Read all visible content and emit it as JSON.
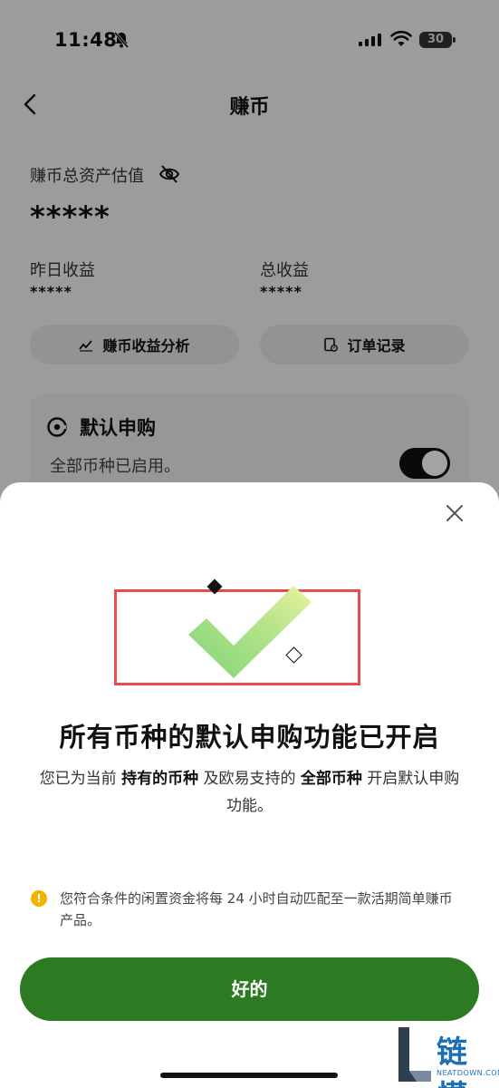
{
  "status_bar": {
    "time": "11:48",
    "battery": "30"
  },
  "nav": {
    "title": "赚币"
  },
  "assets": {
    "label": "赚币总资产估值",
    "value": "*****",
    "yesterday_label": "昨日收益",
    "yesterday_value": "*****",
    "total_label": "总收益",
    "total_value": "*****"
  },
  "actions": {
    "analysis_label": "赚币收益分析",
    "orders_label": "订单记录"
  },
  "auto_subscribe_card": {
    "title": "默认申购",
    "description": "全部币种已启用。",
    "enabled": true
  },
  "sheet": {
    "title": "所有币种的默认申购功能已开启",
    "desc_part1": "您已为当前 ",
    "desc_bold1": "持有的币种",
    "desc_part2": " 及欧易支持的 ",
    "desc_bold2": "全部币种",
    "desc_part3": " 开启默认申购功能。",
    "notice": "您符合条件的闲置资金将每 24 小时自动匹配至一款活期简单赚币产品。",
    "ok_label": "好的"
  },
  "watermark": {
    "text": "链懂",
    "sub": "NEATDOWN.COM"
  },
  "colors": {
    "primary_button": "#2c7a22",
    "highlight_border": "#e84b4b",
    "warning": "#f0b400"
  }
}
